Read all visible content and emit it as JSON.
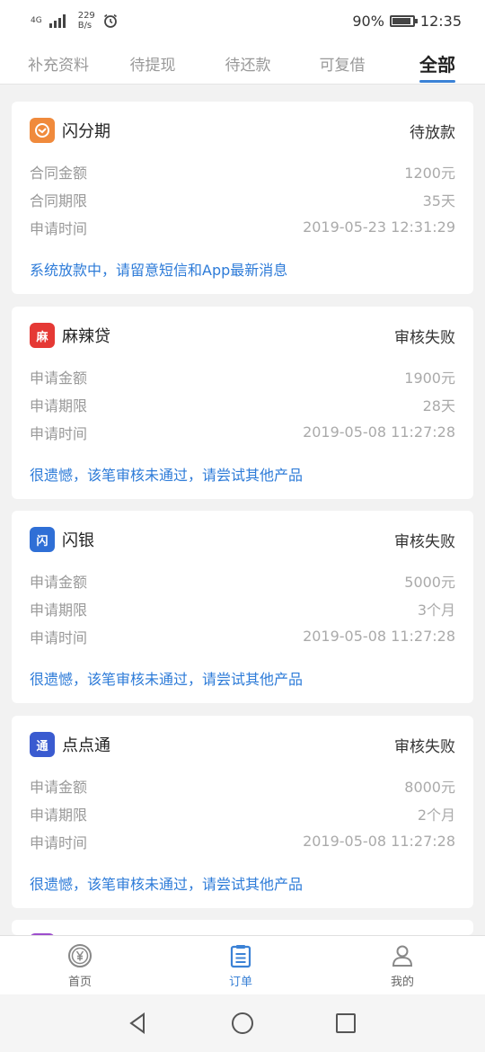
{
  "status_bar": {
    "network": "4G",
    "speed_value": "229",
    "speed_unit": "B/s",
    "battery_text": "90%",
    "battery_level": 0.9,
    "time": "12:35",
    "alarm_icon": "alarm-clock-icon"
  },
  "tabs": [
    {
      "label": "补充资料"
    },
    {
      "label": "待提现"
    },
    {
      "label": "待还款"
    },
    {
      "label": "可复借"
    },
    {
      "label": "全部"
    }
  ],
  "active_tab": "全部",
  "orders": [
    {
      "name": "闪分期",
      "status": "待放款",
      "logo_color": "#f08a3c",
      "logo_glyph": "✉",
      "rows": [
        {
          "label": "合同金额",
          "value": "1200元"
        },
        {
          "label": "合同期限",
          "value": "35天"
        },
        {
          "label": "申请时间",
          "value": "2019-05-23 12:31:29"
        }
      ],
      "notice": "系统放款中，请留意短信和App最新消息"
    },
    {
      "name": "麻辣贷",
      "status": "审核失败",
      "logo_color": "#e53935",
      "logo_glyph": "麻",
      "rows": [
        {
          "label": "申请金额",
          "value": "1900元"
        },
        {
          "label": "申请期限",
          "value": "28天"
        },
        {
          "label": "申请时间",
          "value": "2019-05-08 11:27:28"
        }
      ],
      "notice": "很遗憾，该笔审核未通过，请尝试其他产品"
    },
    {
      "name": "闪银",
      "status": "审核失败",
      "logo_color": "#2f6fd6",
      "logo_glyph": "闪",
      "rows": [
        {
          "label": "申请金额",
          "value": "5000元"
        },
        {
          "label": "申请期限",
          "value": "3个月"
        },
        {
          "label": "申请时间",
          "value": "2019-05-08 11:27:28"
        }
      ],
      "notice": "很遗憾，该笔审核未通过，请尝试其他产品"
    },
    {
      "name": "点点通",
      "status": "审核失败",
      "logo_color": "#3a5bd0",
      "logo_glyph": "通",
      "rows": [
        {
          "label": "申请金额",
          "value": "8000元"
        },
        {
          "label": "申请期限",
          "value": "2个月"
        },
        {
          "label": "申请时间",
          "value": "2019-05-08 11:27:28"
        }
      ],
      "notice": "很遗憾，该笔审核未通过，请尝试其他产品"
    }
  ],
  "partial_card_logo_color": "#9c4dcc",
  "bottom_nav": [
    {
      "label": "首页",
      "icon": "yen-coin-icon"
    },
    {
      "label": "订单",
      "icon": "clipboard-list-icon"
    },
    {
      "label": "我的",
      "icon": "person-icon"
    }
  ],
  "active_nav": "订单",
  "accent_color": "#3b82d6",
  "notice_color": "#2d7bd8"
}
